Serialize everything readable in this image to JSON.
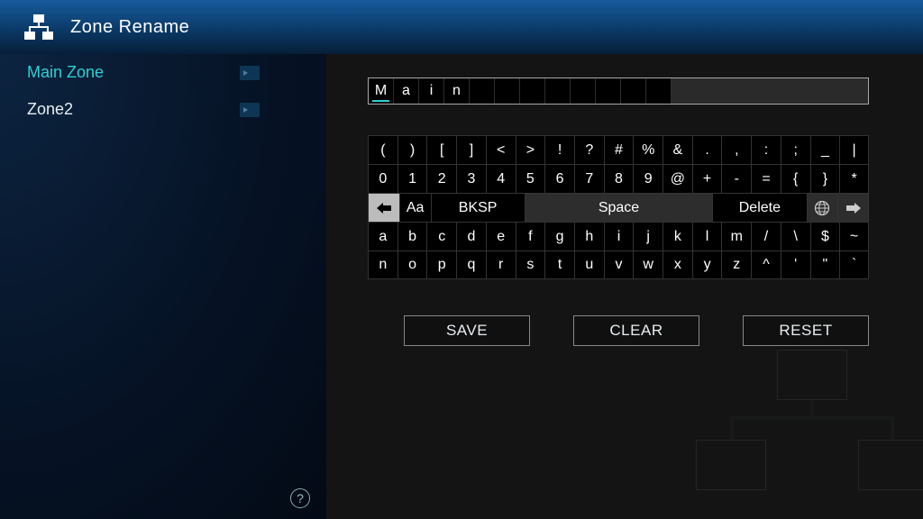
{
  "header": {
    "title": "Zone Rename"
  },
  "sidebar": {
    "items": [
      {
        "label": "Main Zone",
        "active": true
      },
      {
        "label": "Zone2",
        "active": false
      }
    ]
  },
  "entry": {
    "cells": [
      "M",
      "a",
      "i",
      "n",
      "",
      "",
      "",
      "",
      "",
      "",
      "",
      ""
    ],
    "cursor_index": 0
  },
  "keyboard": {
    "row1": [
      "(",
      ")",
      "[",
      "]",
      "<",
      ">",
      "!",
      "?",
      "#",
      "%",
      "&",
      ".",
      ",",
      ":",
      ";",
      "_",
      "|"
    ],
    "row2": [
      "0",
      "1",
      "2",
      "3",
      "4",
      "5",
      "6",
      "7",
      "8",
      "9",
      "@",
      "+",
      "-",
      "=",
      "{",
      "}",
      "*"
    ],
    "row3": {
      "aa": "Aa",
      "bksp": "BKSP",
      "space": "Space",
      "delete": "Delete"
    },
    "row4": [
      "a",
      "b",
      "c",
      "d",
      "e",
      "f",
      "g",
      "h",
      "i",
      "j",
      "k",
      "l",
      "m",
      "/",
      "\\",
      "$",
      "~"
    ],
    "row5": [
      "n",
      "o",
      "p",
      "q",
      "r",
      "s",
      "t",
      "u",
      "v",
      "w",
      "x",
      "y",
      "z",
      "^",
      "'",
      "\"",
      "`"
    ]
  },
  "actions": {
    "save": "SAVE",
    "clear": "CLEAR",
    "reset": "RESET"
  }
}
